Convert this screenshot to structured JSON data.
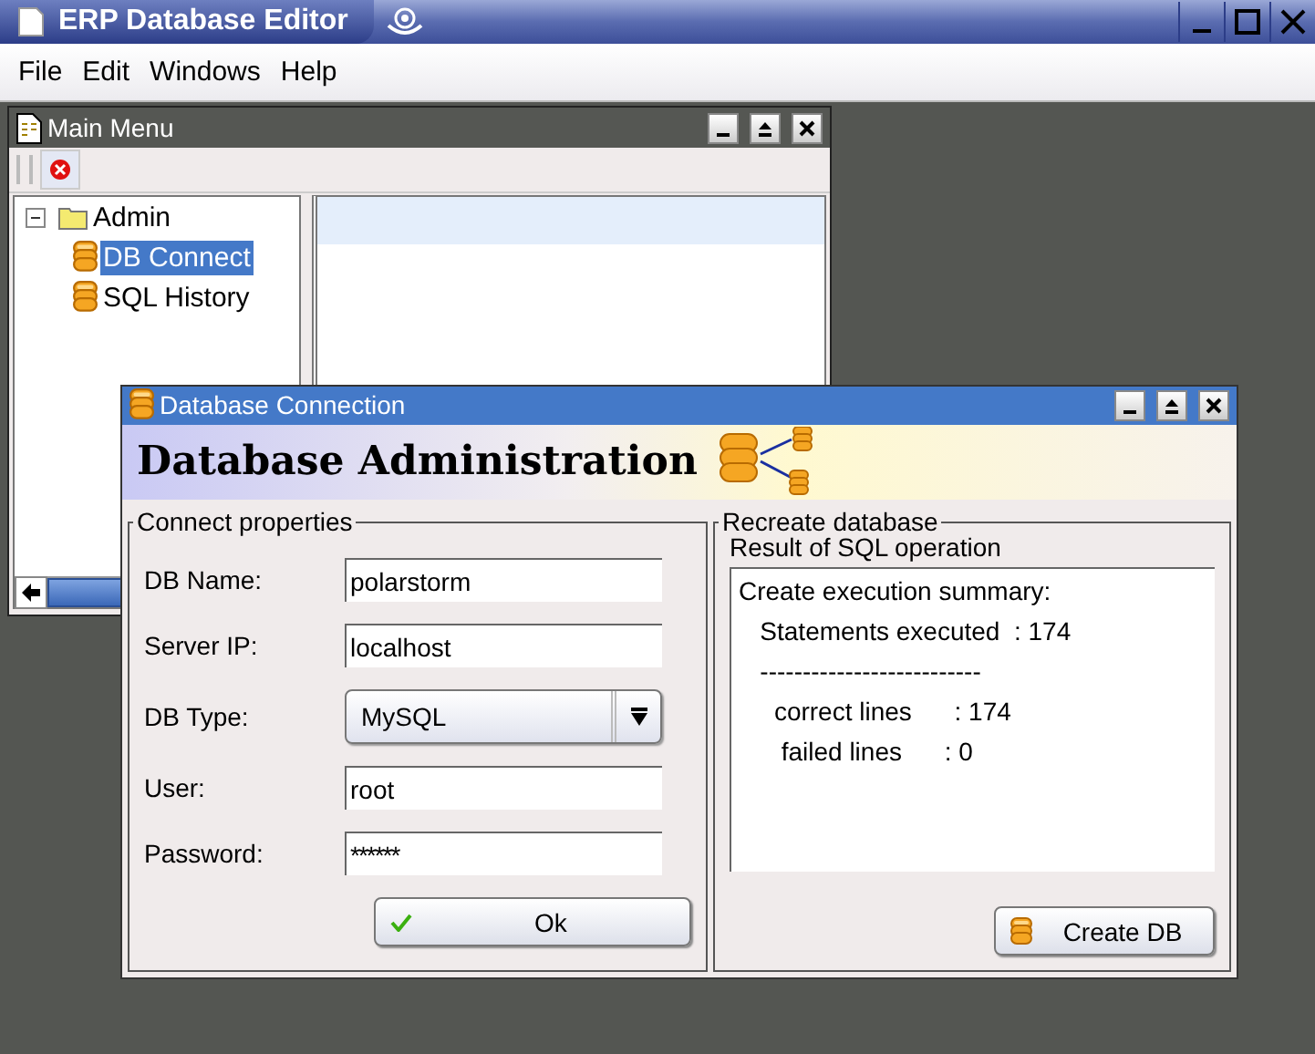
{
  "window": {
    "title": "ERP Database Editor"
  },
  "menu_bar": [
    {
      "label": "File"
    },
    {
      "label": "Edit"
    },
    {
      "label": "Windows"
    },
    {
      "label": "Help"
    }
  ],
  "main_menu": {
    "title": "Main Menu",
    "tree": [
      {
        "label": "Admin",
        "expanded": true,
        "selected": false,
        "children": [
          {
            "label": "DB Connect",
            "selected": true
          },
          {
            "label": "SQL History",
            "selected": false
          }
        ]
      }
    ]
  },
  "dialog": {
    "title": "Database Connection",
    "banner": "Database Administration",
    "connect": {
      "title": "Connect properties",
      "fields": [
        {
          "kind": "text",
          "label": "DB Name:",
          "value": "polarstorm"
        },
        {
          "kind": "text",
          "label": "Server IP:",
          "value": "localhost"
        },
        {
          "kind": "select",
          "label": "DB Type:",
          "value": "MySQL"
        },
        {
          "kind": "text",
          "label": "User:",
          "value": "root"
        },
        {
          "kind": "password",
          "label": "Password:",
          "value": "******"
        }
      ],
      "button": "Ok"
    },
    "recreate": {
      "title": "Recreate database",
      "result_label": "Result of SQL operation",
      "result_lines": [
        "Create execution summary:",
        "   Statements executed  : 174",
        "   --------------------------",
        "     correct lines      : 174",
        "      failed lines      : 0"
      ],
      "button": "Create DB"
    }
  }
}
